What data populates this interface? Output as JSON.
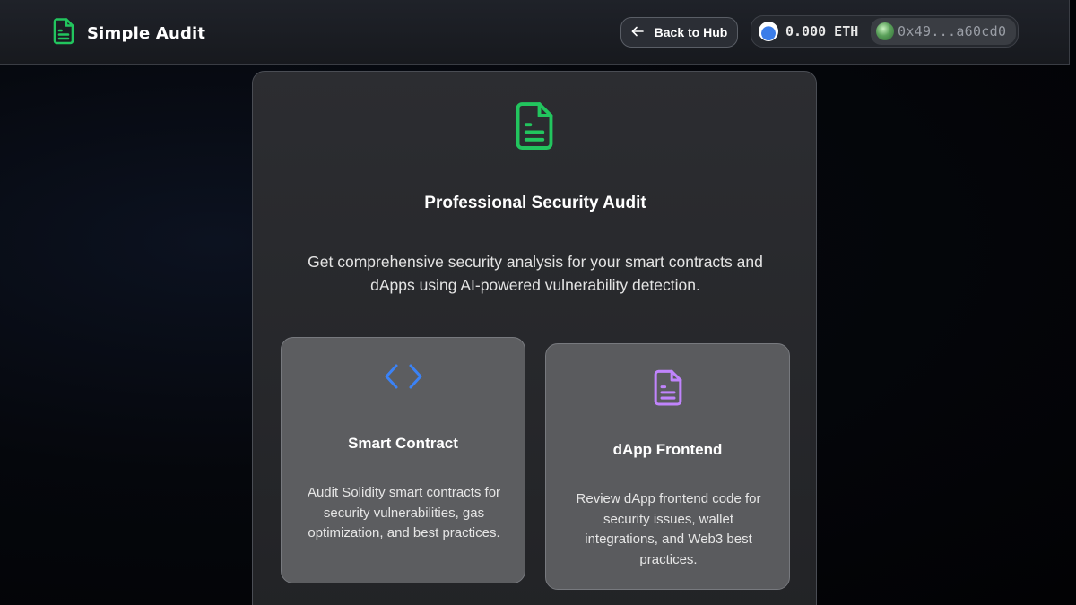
{
  "header": {
    "brand_title": "Simple Audit",
    "brand_icon": "document-icon",
    "back_label": "Back to Hub",
    "back_icon": "arrow-left-icon",
    "wallet": {
      "eth_balance": "0.000 ETH",
      "address": "0x49...a60cd0"
    }
  },
  "main": {
    "icon": "document-icon",
    "title": "Professional Security Audit",
    "description": "Get comprehensive security analysis for your smart contracts and dApps using AI-powered vulnerability detection.",
    "options": [
      {
        "icon": "code-icon",
        "title": "Smart Contract",
        "description": "Audit Solidity smart contracts for security vulnerabilities, gas optimization, and best practices."
      },
      {
        "icon": "document-icon",
        "title": "dApp Frontend",
        "description": "Review dApp frontend code for security issues, wallet integrations, and Web3 best practices."
      }
    ]
  },
  "colors": {
    "brand_green": "#22c55e",
    "code_blue": "#3b82f6",
    "doc_purple": "#c084fc"
  }
}
